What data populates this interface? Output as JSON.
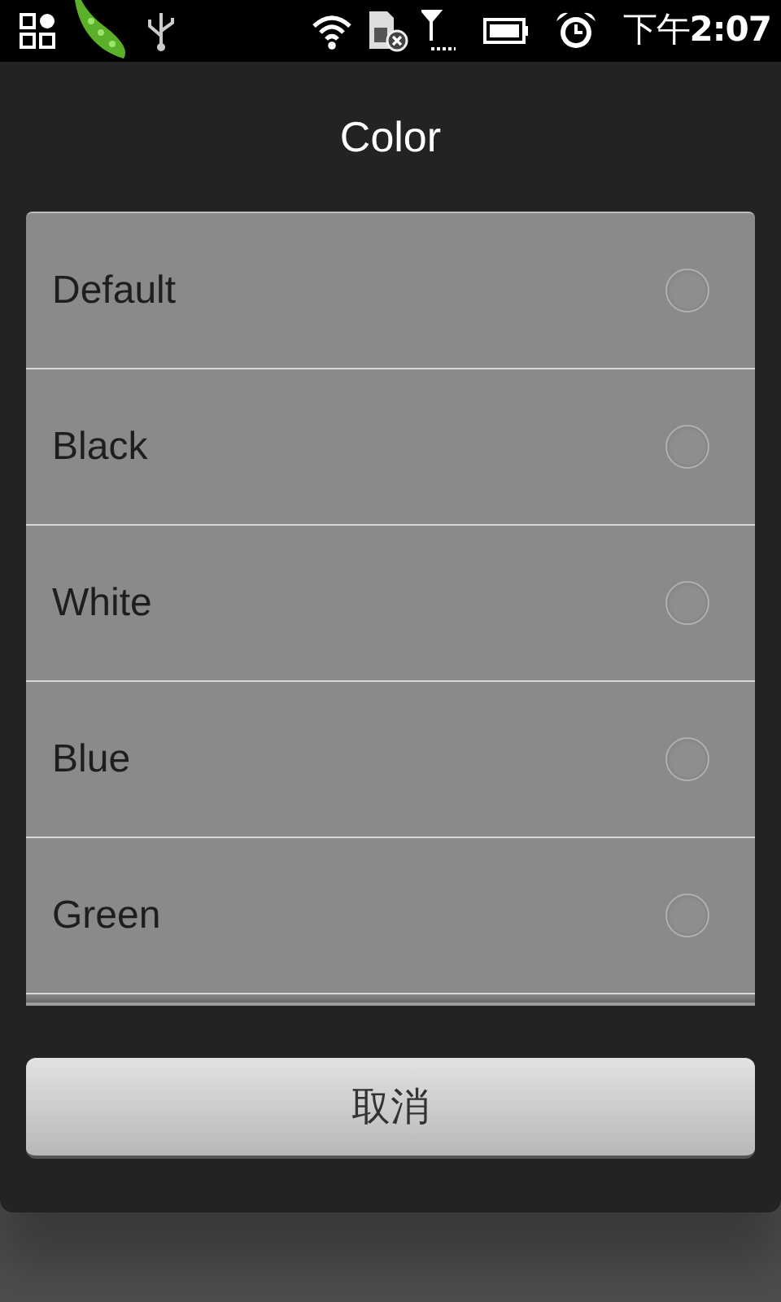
{
  "status_bar": {
    "time": "下午**2:07**"
  },
  "dialog": {
    "title": "Color",
    "options": [
      {
        "label": "Default",
        "selected": false
      },
      {
        "label": "Black",
        "selected": false
      },
      {
        "label": "White",
        "selected": false
      },
      {
        "label": "Blue",
        "selected": false
      },
      {
        "label": "Green",
        "selected": false
      }
    ],
    "buttons": [
      "取消"
    ]
  }
}
